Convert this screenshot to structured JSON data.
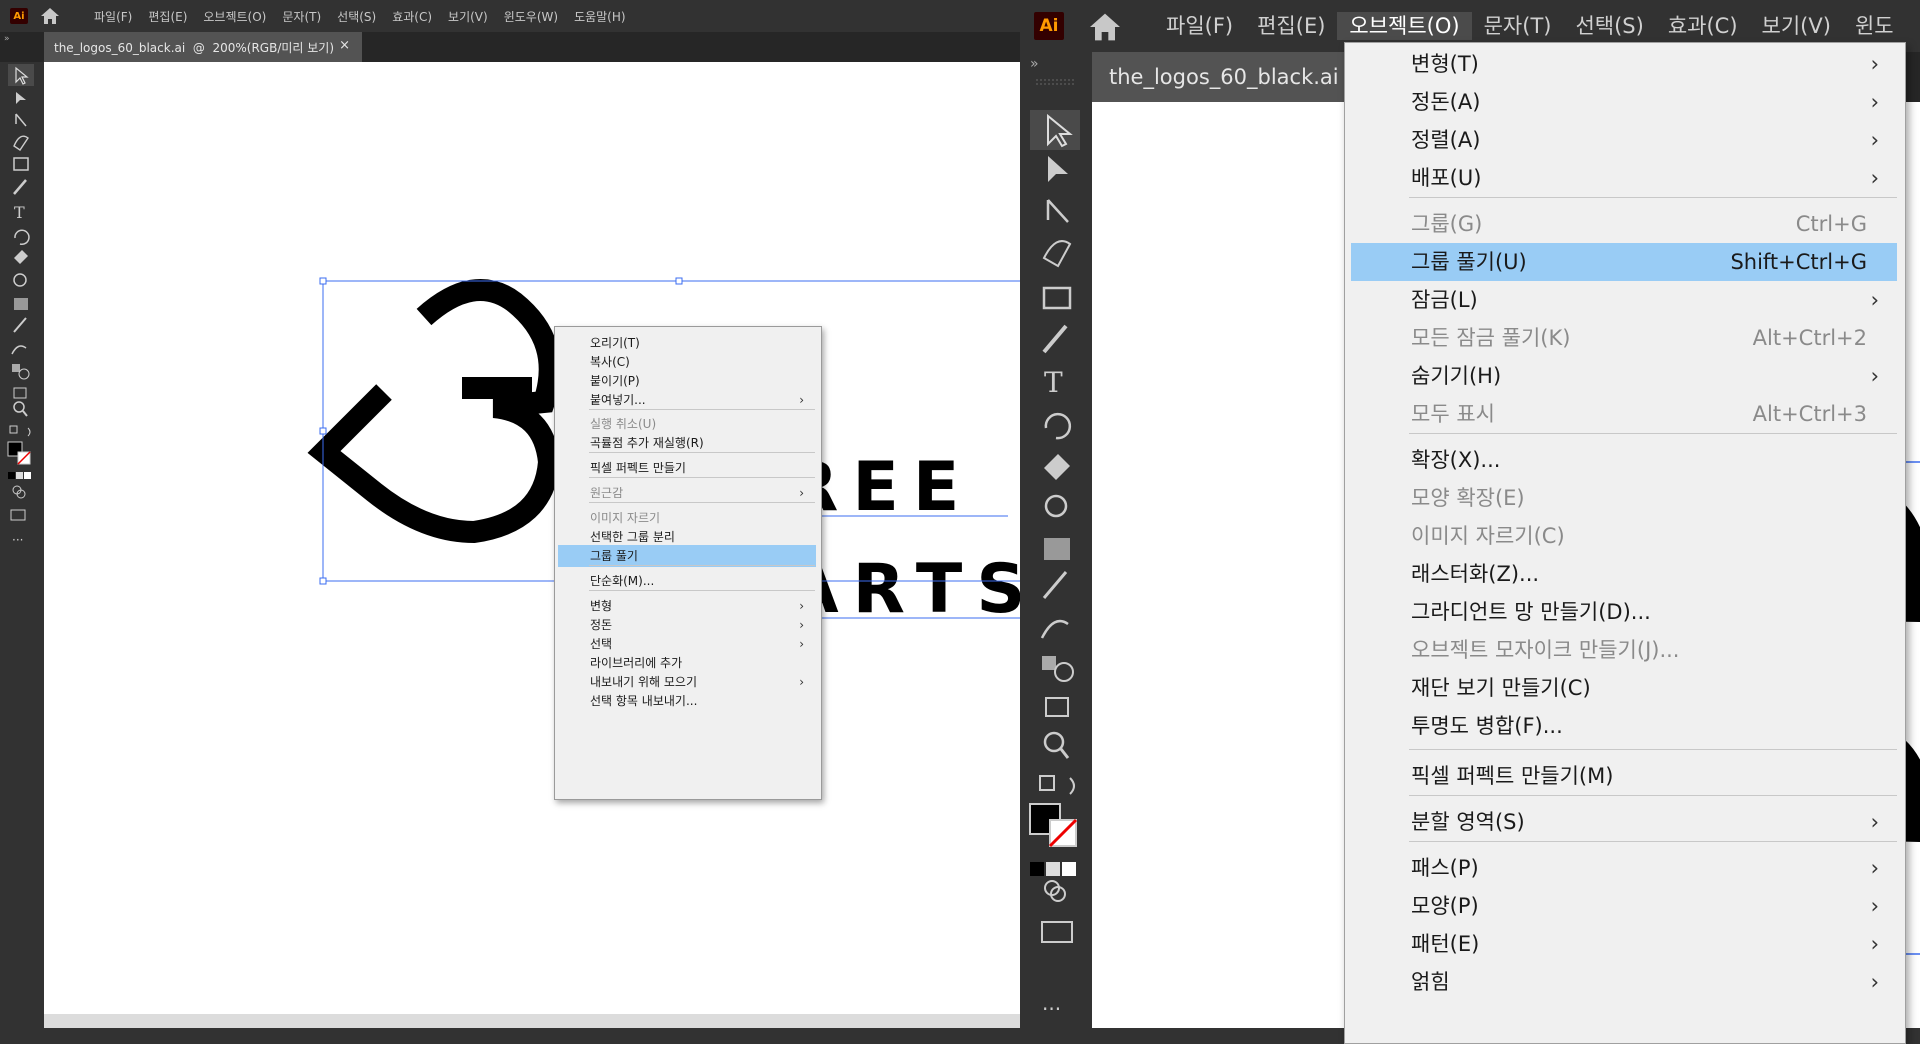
{
  "left": {
    "app_logo": "Ai",
    "menu": [
      "파일(F)",
      "편집(E)",
      "오브젝트(O)",
      "문자(T)",
      "선택(S)",
      "효과(C)",
      "보기(V)",
      "윈도우(W)",
      "도움말(H)"
    ],
    "tab_title": "the_logos_60_black.ai  @  200%(RGB/미리 보기)",
    "tab_close": "×",
    "logo_text_line1": "REE",
    "logo_text_line2": "ARTS",
    "context_menu": [
      {
        "label": "오리기(T)",
        "disabled": false,
        "highlight": false,
        "submenu": false
      },
      {
        "label": "복사(C)",
        "disabled": false,
        "highlight": false,
        "submenu": false
      },
      {
        "label": "붙이기(P)",
        "disabled": false,
        "highlight": false,
        "submenu": false
      },
      {
        "label": "붙여넣기...",
        "disabled": false,
        "highlight": false,
        "submenu": true
      },
      {
        "label": "실행 취소(U)",
        "disabled": true,
        "highlight": false,
        "submenu": false
      },
      {
        "label": "곡률점 추가 재실행(R)",
        "disabled": false,
        "highlight": false,
        "submenu": false
      },
      {
        "label": "픽셀 퍼펙트 만들기",
        "disabled": false,
        "highlight": false,
        "submenu": false
      },
      {
        "label": "원근감",
        "disabled": true,
        "highlight": false,
        "submenu": true
      },
      {
        "label": "이미지 자르기",
        "disabled": true,
        "highlight": false,
        "submenu": false
      },
      {
        "label": "선택한 그룹 분리",
        "disabled": false,
        "highlight": false,
        "submenu": false
      },
      {
        "label": "그룹 풀기",
        "disabled": false,
        "highlight": true,
        "submenu": false
      },
      {
        "label": "단순화(M)...",
        "disabled": false,
        "highlight": false,
        "submenu": false
      },
      {
        "label": "변형",
        "disabled": false,
        "highlight": false,
        "submenu": true
      },
      {
        "label": "정돈",
        "disabled": false,
        "highlight": false,
        "submenu": true
      },
      {
        "label": "선택",
        "disabled": false,
        "highlight": false,
        "submenu": true
      },
      {
        "label": "라이브러리에 추가",
        "disabled": false,
        "highlight": false,
        "submenu": false
      },
      {
        "label": "내보내기 위해 모으기",
        "disabled": false,
        "highlight": false,
        "submenu": true
      },
      {
        "label": "선택 항목 내보내기...",
        "disabled": false,
        "highlight": false,
        "submenu": false
      }
    ]
  },
  "right": {
    "app_logo": "Ai",
    "menu": [
      "파일(F)",
      "편집(E)",
      "오브젝트(O)",
      "문자(T)",
      "선택(S)",
      "효과(C)",
      "보기(V)",
      "윈도"
    ],
    "active_menu_index": 2,
    "tab_title": "the_logos_60_black.ai  @",
    "object_menu": [
      {
        "label": "변형(T)",
        "shortcut": "",
        "disabled": false,
        "highlight": false,
        "submenu": true
      },
      {
        "label": "정돈(A)",
        "shortcut": "",
        "disabled": false,
        "highlight": false,
        "submenu": true
      },
      {
        "label": "정렬(A)",
        "shortcut": "",
        "disabled": false,
        "highlight": false,
        "submenu": true
      },
      {
        "label": "배포(U)",
        "shortcut": "",
        "disabled": false,
        "highlight": false,
        "submenu": true
      },
      {
        "label": "그룹(G)",
        "shortcut": "Ctrl+G",
        "disabled": true,
        "highlight": false,
        "submenu": false
      },
      {
        "label": "그룹 풀기(U)",
        "shortcut": "Shift+Ctrl+G",
        "disabled": false,
        "highlight": true,
        "submenu": false
      },
      {
        "label": "잠금(L)",
        "shortcut": "",
        "disabled": false,
        "highlight": false,
        "submenu": true
      },
      {
        "label": "모든 잠금 풀기(K)",
        "shortcut": "Alt+Ctrl+2",
        "disabled": true,
        "highlight": false,
        "submenu": false
      },
      {
        "label": "숨기기(H)",
        "shortcut": "",
        "disabled": false,
        "highlight": false,
        "submenu": true
      },
      {
        "label": "모두 표시",
        "shortcut": "Alt+Ctrl+3",
        "disabled": true,
        "highlight": false,
        "submenu": false
      },
      {
        "label": "확장(X)...",
        "shortcut": "",
        "disabled": false,
        "highlight": false,
        "submenu": false
      },
      {
        "label": "모양 확장(E)",
        "shortcut": "",
        "disabled": true,
        "highlight": false,
        "submenu": false
      },
      {
        "label": "이미지 자르기(C)",
        "shortcut": "",
        "disabled": true,
        "highlight": false,
        "submenu": false
      },
      {
        "label": "래스터화(Z)...",
        "shortcut": "",
        "disabled": false,
        "highlight": false,
        "submenu": false
      },
      {
        "label": "그라디언트 망 만들기(D)...",
        "shortcut": "",
        "disabled": false,
        "highlight": false,
        "submenu": false
      },
      {
        "label": "오브젝트 모자이크 만들기(J)...",
        "shortcut": "",
        "disabled": true,
        "highlight": false,
        "submenu": false
      },
      {
        "label": "재단 보기 만들기(C)",
        "shortcut": "",
        "disabled": false,
        "highlight": false,
        "submenu": false
      },
      {
        "label": "투명도 병합(F)...",
        "shortcut": "",
        "disabled": false,
        "highlight": false,
        "submenu": false
      },
      {
        "label": "픽셀 퍼펙트 만들기(M)",
        "shortcut": "",
        "disabled": false,
        "highlight": false,
        "submenu": false
      },
      {
        "label": "분할 영역(S)",
        "shortcut": "",
        "disabled": false,
        "highlight": false,
        "submenu": true
      },
      {
        "label": "패스(P)",
        "shortcut": "",
        "disabled": false,
        "highlight": false,
        "submenu": true
      },
      {
        "label": "모양(P)",
        "shortcut": "",
        "disabled": false,
        "highlight": false,
        "submenu": true
      },
      {
        "label": "패턴(E)",
        "shortcut": "",
        "disabled": false,
        "highlight": false,
        "submenu": true
      },
      {
        "label": "얽힘",
        "shortcut": "",
        "disabled": false,
        "highlight": false,
        "submenu": true
      }
    ]
  },
  "colors": {
    "chrome_bg": "#323232",
    "tab_active": "#535353",
    "menu_bg": "#f0f0f0",
    "menu_highlight": "#99ccf5",
    "selection_blue": "#3b6cf0",
    "ai_logo_bg": "#330000",
    "ai_logo_fg": "#ff9a00"
  }
}
